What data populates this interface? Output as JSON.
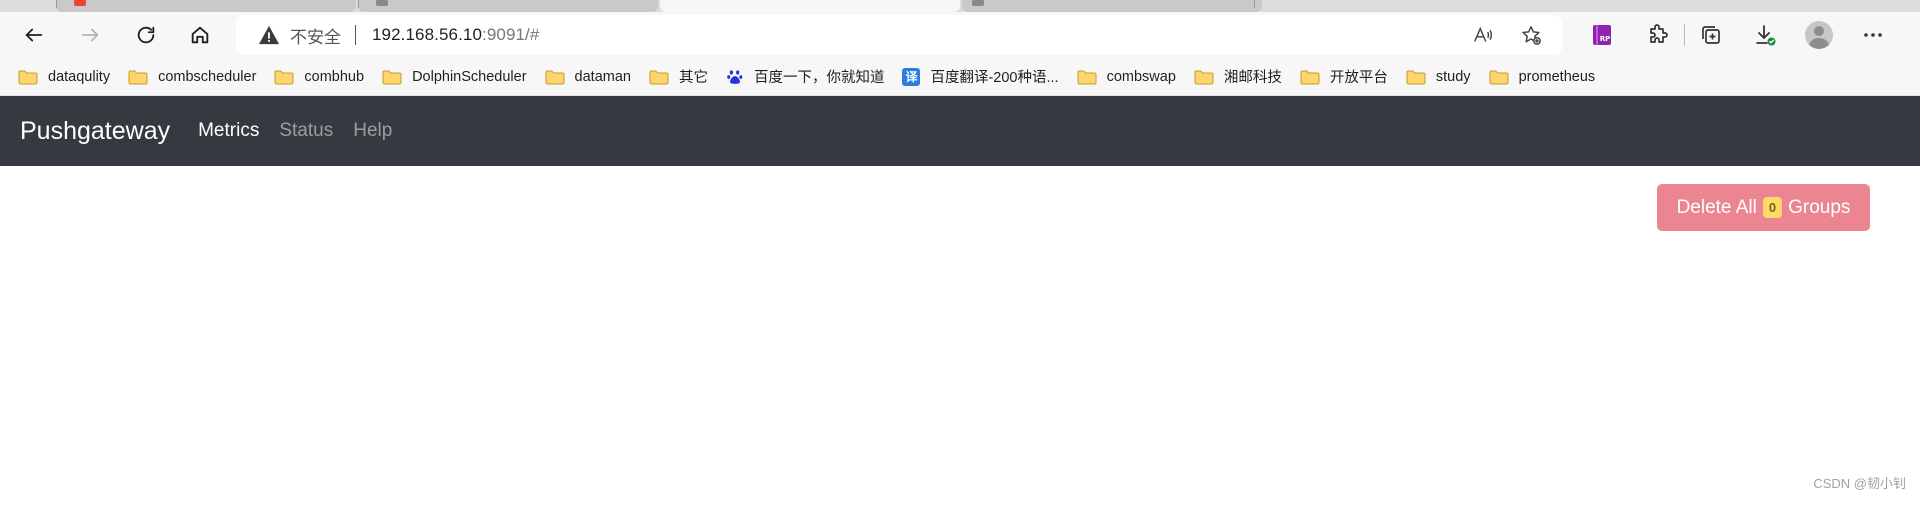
{
  "browser": {
    "security_label": "不安全",
    "url_host": "192.168.56.10",
    "url_rest": ":9091/#",
    "bookmarks": [
      {
        "label": "dataqulity",
        "icon": "folder-icon"
      },
      {
        "label": "combscheduler",
        "icon": "folder-icon"
      },
      {
        "label": "combhub",
        "icon": "folder-icon"
      },
      {
        "label": "DolphinScheduler",
        "icon": "folder-icon"
      },
      {
        "label": "dataman",
        "icon": "folder-icon"
      },
      {
        "label": "其它",
        "icon": "folder-icon"
      },
      {
        "label": "百度一下，你就知道",
        "icon": "baidu-paw-icon"
      },
      {
        "label": "百度翻译-200种语...",
        "icon": "fanyi-icon",
        "icon_text": "译"
      },
      {
        "label": "combswap",
        "icon": "folder-icon"
      },
      {
        "label": "湘邮科技",
        "icon": "folder-icon"
      },
      {
        "label": "开放平台",
        "icon": "folder-icon"
      },
      {
        "label": "study",
        "icon": "folder-icon"
      },
      {
        "label": "prometheus",
        "icon": "folder-icon"
      }
    ]
  },
  "app": {
    "brand": "Pushgateway",
    "nav": [
      {
        "label": "Metrics",
        "active": true
      },
      {
        "label": "Status",
        "active": false
      },
      {
        "label": "Help",
        "active": false
      }
    ],
    "delete_button": {
      "prefix": "Delete All",
      "count": "0",
      "suffix": "Groups"
    }
  },
  "watermark": "CSDN @韧小钊",
  "colors": {
    "navbar_bg": "#343a40",
    "delete_button_bg": "#eb8591",
    "badge_bg": "#ffd966",
    "folder_fill": "#fcd56d",
    "folder_stroke": "#c99a2e"
  }
}
